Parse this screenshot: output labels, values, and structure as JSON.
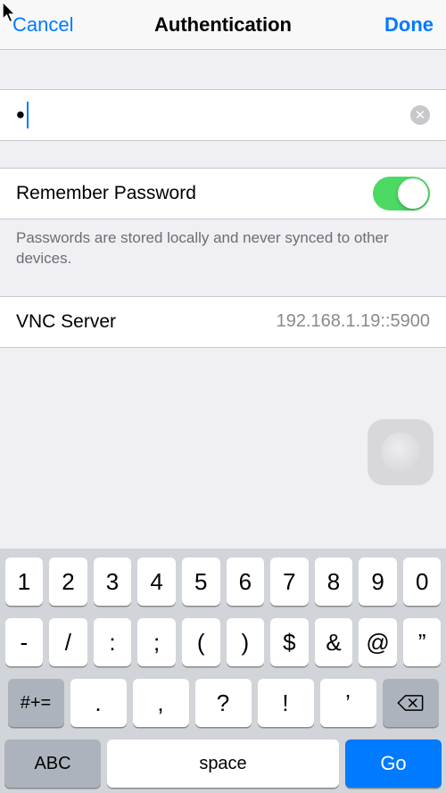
{
  "nav": {
    "cancel": "Cancel",
    "title": "Authentication",
    "done": "Done"
  },
  "password": {
    "masked_value": "•",
    "clear_icon": "✕"
  },
  "remember": {
    "label": "Remember Password",
    "on": true,
    "note": "Passwords are stored locally and never synced to other devices."
  },
  "server": {
    "label": "VNC Server",
    "value": "192.168.1.19::5900"
  },
  "keyboard": {
    "row1": [
      "1",
      "2",
      "3",
      "4",
      "5",
      "6",
      "7",
      "8",
      "9",
      "0"
    ],
    "row2": [
      "-",
      "/",
      ":",
      ";",
      "(",
      ")",
      "$",
      "&",
      "@",
      "”"
    ],
    "row3_special": "#+=",
    "row3": [
      ".",
      ",",
      "?",
      "!",
      "’"
    ],
    "row4_abc": "ABC",
    "row4_space": "space",
    "row4_go": "Go"
  }
}
